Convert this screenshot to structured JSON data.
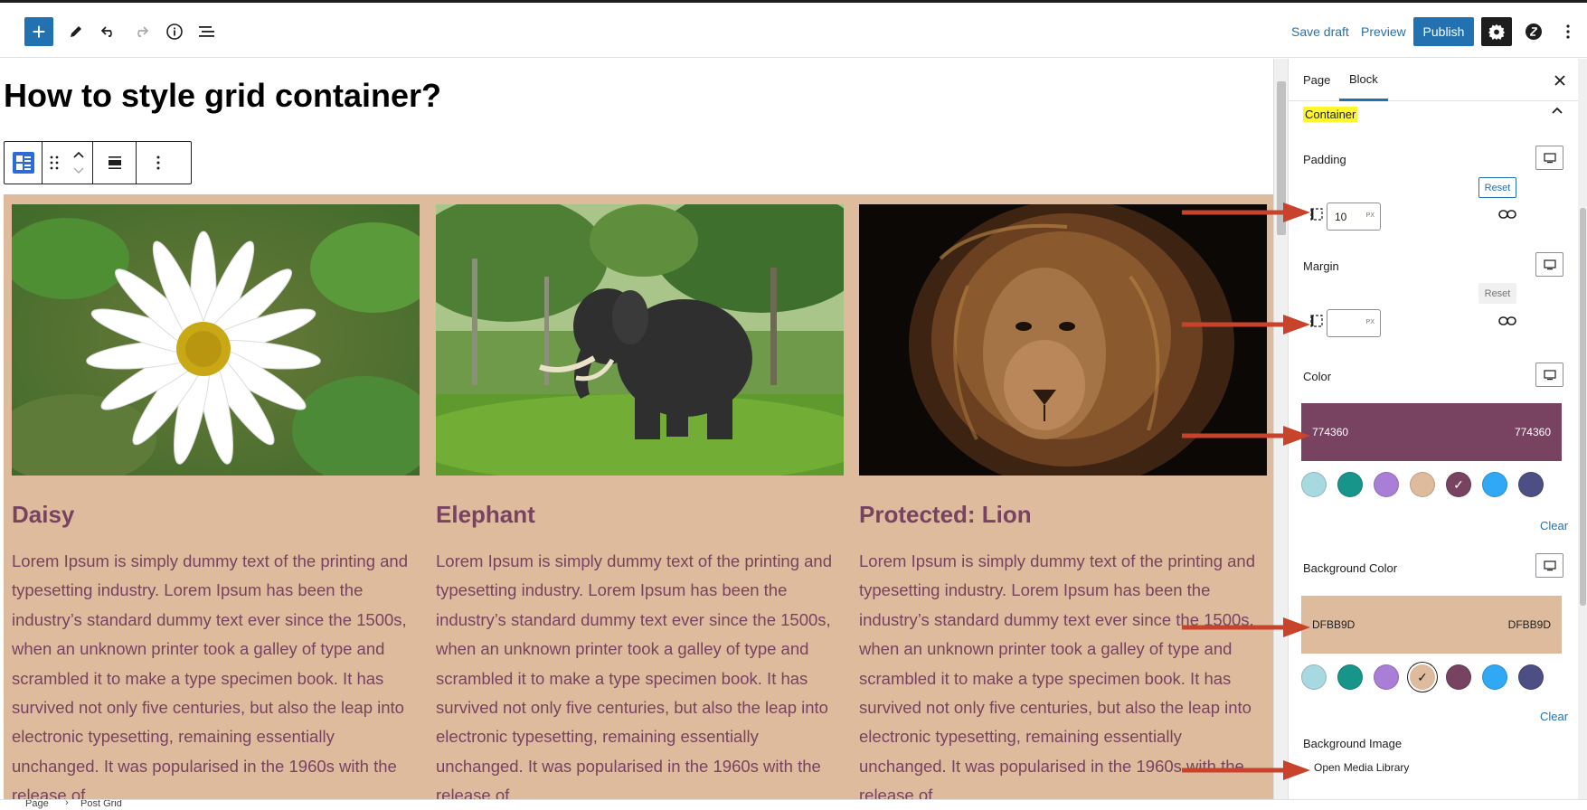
{
  "toolbar": {
    "add_icon": "plus-icon",
    "tool_icons": [
      "pencil-icon",
      "undo-icon",
      "redo-icon",
      "info-icon",
      "list-view-icon"
    ],
    "save_draft": "Save draft",
    "preview": "Preview",
    "publish": "Publish",
    "settings_icon": "gear-icon",
    "plugin_icon": "plugin-icon",
    "more_icon": "vertical-ellipsis-icon"
  },
  "editor": {
    "title": "How to style grid container?",
    "block_toolbar_icons": [
      "grid-block-icon",
      "drag-handle-icon",
      "move-up-down-icon",
      "align-icon",
      "more-options-icon"
    ]
  },
  "cards": [
    {
      "title": "Daisy",
      "text": "Lorem Ipsum is simply dummy text of the printing and typesetting industry. Lorem Ipsum has been the industry’s standard dummy text ever since the 1500s, when an unknown printer took a galley of type and scrambled it to make a type specimen book. It has survived not only five centuries, but also the leap into electronic typesetting, remaining essentially unchanged. It was popularised in the 1960s with the release of"
    },
    {
      "title": "Elephant",
      "text": "Lorem Ipsum is simply dummy text of the printing and typesetting industry. Lorem Ipsum has been the industry’s standard dummy text ever since the 1500s, when an unknown printer took a galley of type and scrambled it to make a type specimen book. It has survived not only five centuries, but also the leap into electronic typesetting, remaining essentially unchanged. It was popularised in the 1960s with the release of"
    },
    {
      "title": "Protected: Lion",
      "text": "Lorem Ipsum is simply dummy text of the printing and typesetting industry. Lorem Ipsum has been the industry’s standard dummy text ever since the 1500s, when an unknown printer took a galley of type and scrambled it to make a type specimen book. It has survived not only five centuries, but also the leap into electronic typesetting, remaining essentially unchanged. It was popularised in the 1960s with the release of"
    }
  ],
  "sidebar": {
    "tabs": [
      "Page",
      "Block"
    ],
    "active_tab": "Block",
    "close_icon": "close-icon",
    "section_title": "Container",
    "padding": {
      "label": "Padding",
      "reset": "Reset",
      "value": "10",
      "unit": "PX"
    },
    "margin": {
      "label": "Margin",
      "reset": "Reset",
      "value": "",
      "unit": "PX"
    },
    "color": {
      "label": "Color",
      "hex": "774360",
      "clear": "Clear"
    },
    "background_color": {
      "label": "Background Color",
      "hex": "DFBB9D",
      "clear": "Clear"
    },
    "background_image": {
      "label": "Background Image",
      "button": "Open Media Library"
    },
    "swatches": [
      "#a8d8e0",
      "#18958a",
      "#a97ed6",
      "#dfbb9d",
      "#774360",
      "#30a8f4",
      "#4d4e84"
    ]
  },
  "footer": {
    "breadcrumb": [
      "Page",
      "Post Grid"
    ]
  },
  "colors": {
    "accent": "#2271b1",
    "text_color": "#774360",
    "background": "#DFBB9D",
    "annotation_arrow": "#c8432b"
  }
}
